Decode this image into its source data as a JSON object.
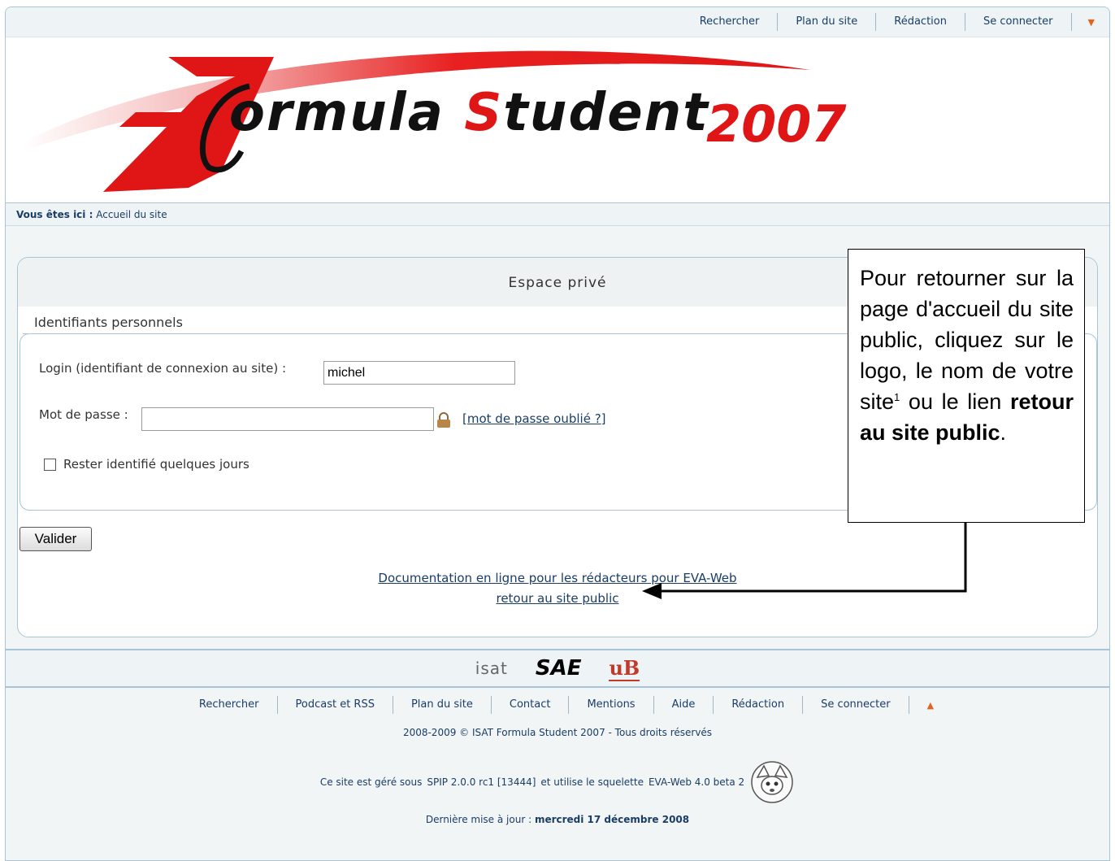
{
  "top_nav": {
    "items": [
      "Rechercher",
      "Plan du site",
      "Rédaction",
      "Se connecter"
    ]
  },
  "banner": {
    "logo_prefix": "ormula ",
    "logo_s": "S",
    "logo_rest": "tudent",
    "logo_year": "2007"
  },
  "breadcrumb": {
    "label": "Vous êtes ici :",
    "current": "Accueil du site"
  },
  "login_box": {
    "title": "Espace privé",
    "legend": "Identifiants personnels",
    "login_label": "Login (identifiant de connexion au site) :",
    "login_value": "michel",
    "password_label": "Mot de passe :",
    "password_value": "",
    "forgot_link": "mot de passe oublié ?",
    "forgot_open": "[",
    "forgot_close": "]",
    "remember_label": "Rester identifié quelques jours",
    "submit_label": "Valider",
    "doc_link": "Documentation en ligne pour les rédacteurs pour EVA-Web",
    "back_link": "retour au site public"
  },
  "callout": {
    "text_before": "Pour retourner sur la page d'accueil du site public, cliquez sur le logo, le nom de votre site",
    "footnote_mark": "1",
    "text_middle": " ou le lien ",
    "text_bold": "retour au site public",
    "text_end": "."
  },
  "footer": {
    "logos": [
      "isat",
      "SAE",
      "uB"
    ],
    "nav_items": [
      "Rechercher",
      "Podcast et RSS",
      "Plan du site",
      "Contact",
      "Mentions",
      "Aide",
      "Rédaction",
      "Se connecter"
    ],
    "copyright": "2008-2009 © ISAT Formula Student 2007 - Tous droits réservés",
    "spip_prefix": "Ce site est géré sous",
    "spip_version": "SPIP 2.0.0 rc1 [13444]",
    "spip_middle": "et utilise le squelette",
    "skeleton": "EVA-Web 4.0 beta 2",
    "updated_label": "Dernière mise à jour :",
    "updated_date": "mercredi 17 décembre 2008"
  },
  "colors": {
    "accent_red": "#e01616",
    "link_blue": "#1a3d66",
    "arrow_orange": "#e0661f",
    "border_blue": "#a8c4d6"
  }
}
